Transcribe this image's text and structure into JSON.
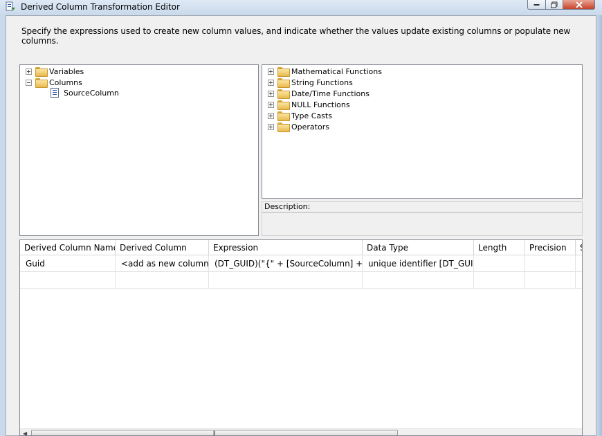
{
  "window": {
    "title": "Derived Column Transformation Editor"
  },
  "instruction": "Specify the expressions used to create new column values, and indicate whether the values update existing columns or populate new columns.",
  "left_tree": {
    "items": [
      {
        "label": "Variables",
        "expander": "plus",
        "icon": "folder-icon"
      },
      {
        "label": "Columns",
        "expander": "minus",
        "icon": "folder-icon"
      },
      {
        "label": "SourceColumn",
        "icon": "column-icon"
      }
    ]
  },
  "right_tree": {
    "items": [
      {
        "label": "Mathematical Functions",
        "expander": "plus",
        "icon": "folder-icon"
      },
      {
        "label": "String Functions",
        "expander": "plus",
        "icon": "folder-icon"
      },
      {
        "label": "Date/Time Functions",
        "expander": "plus",
        "icon": "folder-icon"
      },
      {
        "label": "NULL Functions",
        "expander": "plus",
        "icon": "folder-icon"
      },
      {
        "label": "Type Casts",
        "expander": "plus",
        "icon": "folder-icon"
      },
      {
        "label": "Operators",
        "expander": "plus",
        "icon": "folder-icon"
      }
    ]
  },
  "description": {
    "label": "Description:",
    "text": ""
  },
  "grid": {
    "columns": [
      "Derived Column Name",
      "Derived Column",
      "Expression",
      "Data Type",
      "Length",
      "Precision",
      "S"
    ],
    "rows": [
      [
        "Guid",
        "<add as new column>",
        "(DT_GUID)(\"{\" + [SourceColumn] + \"}\")",
        "unique identifier [DT_GUID]",
        "",
        "",
        ""
      ],
      [
        "",
        "",
        "",
        "",
        "",
        "",
        ""
      ]
    ]
  },
  "colors": {
    "window_frame": "#c9d9ea",
    "client_bg": "#f0f0f0",
    "close_button": "#c7422a"
  }
}
